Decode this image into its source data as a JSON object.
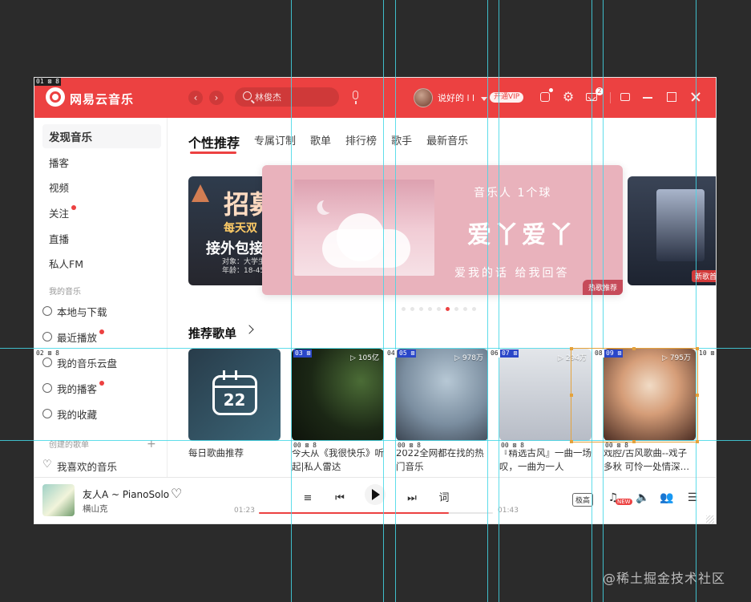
{
  "header": {
    "app_title": "网易云音乐",
    "search_placeholder": "林俊杰",
    "username": "说好的 l l",
    "vip_label": "开通VIP",
    "mail_count": "2"
  },
  "sidebar": {
    "items": [
      {
        "label": "发现音乐"
      },
      {
        "label": "播客"
      },
      {
        "label": "视频"
      },
      {
        "label": "关注"
      },
      {
        "label": "直播"
      },
      {
        "label": "私人FM"
      }
    ],
    "my_music_label": "我的音乐",
    "my_music_items": [
      {
        "label": "本地与下载"
      },
      {
        "label": "最近播放"
      },
      {
        "label": "我的音乐云盘"
      },
      {
        "label": "我的播客"
      },
      {
        "label": "我的收藏"
      }
    ],
    "created_playlists_label": "创建的歌单",
    "liked_label": "我喜欢的音乐"
  },
  "main": {
    "tabs": [
      {
        "label": "个性推荐"
      },
      {
        "label": "专属订制"
      },
      {
        "label": "歌单"
      },
      {
        "label": "排行榜"
      },
      {
        "label": "歌手"
      },
      {
        "label": "最新音乐"
      }
    ],
    "banner": {
      "left": {
        "big": "招募",
        "line1": "每天双",
        "line2": "接外包接",
        "line3": "对象：大学生、\n年龄：18-45"
      },
      "center": {
        "t1": "音乐人 1个球",
        "t2": "爱丫爱丫",
        "t3": "爱我的话 给我回答",
        "tag": "热歌推荐"
      },
      "right": {
        "tag": "新歌首发"
      },
      "dots_count": 9,
      "active_dot_index": 5
    },
    "section_title": "推荐歌单",
    "playlists": [
      {
        "title": "每日歌曲推荐",
        "play_count": "",
        "calendar_day": "22"
      },
      {
        "title": "今天从《我很快乐》听起|私人雷达",
        "play_count": "105亿"
      },
      {
        "title": "2022全网都在找的热门音乐",
        "play_count": "978万"
      },
      {
        "title": "『精选古风』一曲一场叹，一曲为一人",
        "play_count": "294万"
      },
      {
        "title": "戏腔/古风歌曲--戏子多秋 可怜一处情深…",
        "play_count": "795万"
      }
    ]
  },
  "player": {
    "song": "友人A ~ PianoSolo",
    "artist": "横山克",
    "time_current": "01:23",
    "time_total": "01:43",
    "progress_ratio": 0.81,
    "quality": "极高",
    "lyrics_label": "词",
    "new_badge": "NEW"
  },
  "overlay_labels": {
    "top_left": "01 ⊠ 8",
    "left_mid": "02 ⊠ 8",
    "card_c1": "03 ⊠",
    "card_c2a": "04",
    "card_c2b": "05 ⊠",
    "card_c3a": "06",
    "card_c3b": "07 ⊠",
    "card_c4a": "08",
    "card_c4b": "09 ⊠",
    "right_edge": "10 ⊠",
    "bottom_c1": "00 ⊠ 8",
    "bottom_c2": "00 ⊠ 8",
    "bottom_c3": "00 ⊠ 8",
    "bottom_c4": "00 ⊠ 8"
  },
  "watermark": "@稀土掘金技术社区",
  "colors": {
    "accent": "#ec4141",
    "guide": "#43d7e6",
    "selection": "#e4a23b"
  },
  "icons": {
    "search": "search-icon",
    "mic": "mic-icon",
    "gear": "gear-icon",
    "mail": "mail-icon",
    "close": "close-icon"
  }
}
